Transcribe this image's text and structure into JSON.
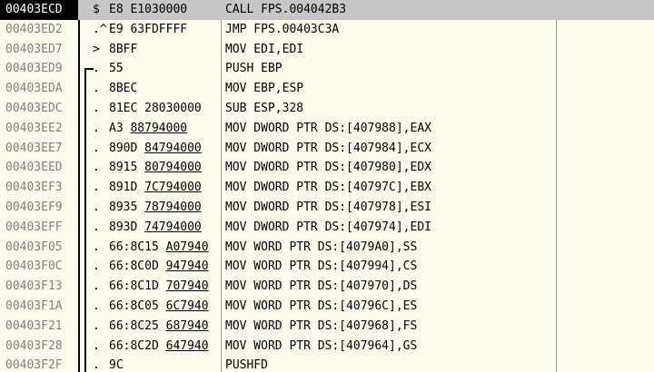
{
  "rows": [
    {
      "addr": "00403ECD",
      "marker": "$",
      "bytes": "E8 E1030000",
      "bytes_ul": "",
      "disasm": "CALL FPS.004042B3",
      "selected": true
    },
    {
      "addr": "00403ED2",
      "marker": ".^",
      "bytes": "E9 63FDFFFF",
      "bytes_ul": "",
      "disasm": "JMP FPS.00403C3A"
    },
    {
      "addr": "00403ED7",
      "marker": ">",
      "bytes": "8BFF",
      "bytes_ul": "",
      "disasm": "MOV EDI,EDI"
    },
    {
      "addr": "00403ED9",
      "marker": ".",
      "bytes": "55",
      "bytes_ul": "",
      "disasm": "PUSH EBP"
    },
    {
      "addr": "00403EDA",
      "marker": ".",
      "bytes": "8BEC",
      "bytes_ul": "",
      "disasm": "MOV EBP,ESP"
    },
    {
      "addr": "00403EDC",
      "marker": ".",
      "bytes": "81EC 28030000",
      "bytes_ul": "",
      "disasm": "SUB ESP,328"
    },
    {
      "addr": "00403EE2",
      "marker": ".",
      "bytes": "A3 ",
      "bytes_ul": "88794000",
      "disasm": "MOV DWORD PTR DS:[407988],EAX"
    },
    {
      "addr": "00403EE7",
      "marker": ".",
      "bytes": "890D ",
      "bytes_ul": "84794000",
      "disasm": "MOV DWORD PTR DS:[407984],ECX"
    },
    {
      "addr": "00403EED",
      "marker": ".",
      "bytes": "8915 ",
      "bytes_ul": "80794000",
      "disasm": "MOV DWORD PTR DS:[407980],EDX"
    },
    {
      "addr": "00403EF3",
      "marker": ".",
      "bytes": "891D ",
      "bytes_ul": "7C794000",
      "disasm": "MOV DWORD PTR DS:[40797C],EBX"
    },
    {
      "addr": "00403EF9",
      "marker": ".",
      "bytes": "8935 ",
      "bytes_ul": "78794000",
      "disasm": "MOV DWORD PTR DS:[407978],ESI"
    },
    {
      "addr": "00403EFF",
      "marker": ".",
      "bytes": "893D ",
      "bytes_ul": "74794000",
      "disasm": "MOV DWORD PTR DS:[407974],EDI"
    },
    {
      "addr": "00403F05",
      "marker": ".",
      "bytes": "66:8C15 ",
      "bytes_ul": "A07940",
      "disasm": "MOV WORD PTR DS:[4079A0],SS"
    },
    {
      "addr": "00403F0C",
      "marker": ".",
      "bytes": "66:8C0D ",
      "bytes_ul": "947940",
      "disasm": "MOV WORD PTR DS:[407994],CS"
    },
    {
      "addr": "00403F13",
      "marker": ".",
      "bytes": "66:8C1D ",
      "bytes_ul": "707940",
      "disasm": "MOV WORD PTR DS:[407970],DS"
    },
    {
      "addr": "00403F1A",
      "marker": ".",
      "bytes": "66:8C05 ",
      "bytes_ul": "6C7940",
      "disasm": "MOV WORD PTR DS:[40796C],ES"
    },
    {
      "addr": "00403F21",
      "marker": ".",
      "bytes": "66:8C25 ",
      "bytes_ul": "687940",
      "disasm": "MOV WORD PTR DS:[407968],FS"
    },
    {
      "addr": "00403F28",
      "marker": ".",
      "bytes": "66:8C2D ",
      "bytes_ul": "647940",
      "disasm": "MOV WORD PTR DS:[407964],GS"
    },
    {
      "addr": "00403F2F",
      "marker": ".",
      "bytes": "9C",
      "bytes_ul": "",
      "disasm": "PUSHFD"
    }
  ]
}
